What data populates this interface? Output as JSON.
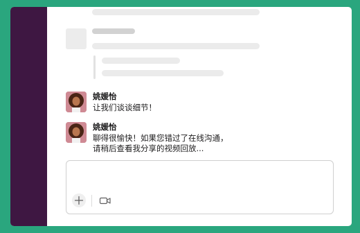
{
  "messages": [
    {
      "sender": "姚媛怡",
      "lines": [
        "让我们谈谈细节！"
      ]
    },
    {
      "sender": "姚媛怡",
      "lines": [
        "聊得很愉快！如果您错过了在线沟通，",
        "请稍后查看我分享的视频回放..."
      ]
    }
  ],
  "composer": {
    "value": "",
    "placeholder": ""
  },
  "icons": {
    "plus": "plus-icon",
    "video": "video-camera-icon"
  },
  "colors": {
    "background": "#2aa67e",
    "sidebar": "#3e1742",
    "surface": "#ffffff",
    "text": "#1d1c1d"
  }
}
